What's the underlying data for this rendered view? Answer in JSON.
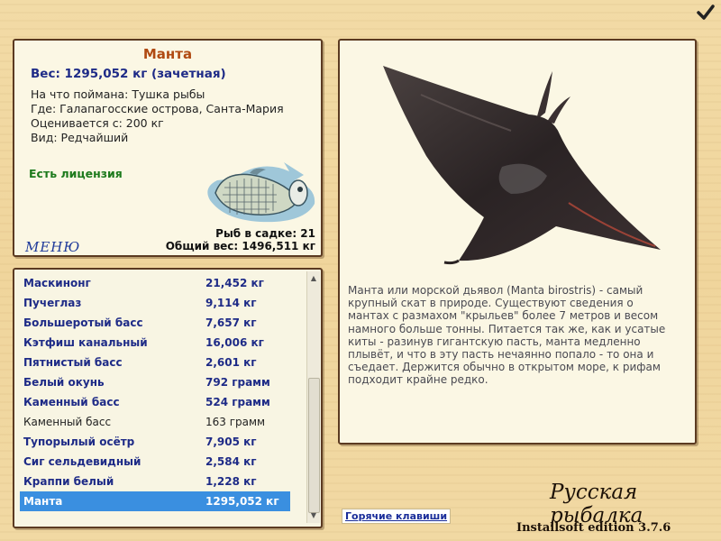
{
  "fish": {
    "name": "Манта",
    "weight": "Вес: 1295,052 кг (зачетная)",
    "caught_on": "На что поймана: Тушка рыбы",
    "location": "Где: Галапагосские острова, Санта-Мария",
    "valued_from": "Оценивается с: 200 кг",
    "species_type": "Вид: Редчайший",
    "license": "Есть лицензия",
    "description": "Манта или морской дьявол (Manta birostris) - самый крупный скат в природе. Существуют сведения о мантах с размахом \"крыльев\" более 7 метров и весом намного больше тонны. Питается так же, как и усатые киты - разинув гигантскую пасть, манта медленно плывёт, и что в эту пасть нечаянно попало - то она и съедает. Держится обычно в открытом море, к рифам подходит крайне редко."
  },
  "menu_label": "МЕНЮ",
  "stats": {
    "fish_in_keepnet": "Рыб в садке: 21",
    "total_weight": "Общий вес: 1496,511 кг"
  },
  "catch_list": [
    {
      "name": "Маскинонг",
      "weight": "21,452 кг",
      "bold": true
    },
    {
      "name": "Пучеглаз",
      "weight": "9,114 кг",
      "bold": true
    },
    {
      "name": "Большеротый басс",
      "weight": "7,657 кг",
      "bold": true
    },
    {
      "name": "Кэтфиш канальный",
      "weight": "16,006 кг",
      "bold": true
    },
    {
      "name": "Пятнистый басс",
      "weight": "2,601 кг",
      "bold": true
    },
    {
      "name": "Белый окунь",
      "weight": "792 грамм",
      "bold": true
    },
    {
      "name": "Каменный басс",
      "weight": "524 грамм",
      "bold": true
    },
    {
      "name": "Каменный басс",
      "weight": "163 грамм",
      "bold": false
    },
    {
      "name": "Тупорылый осётр",
      "weight": "7,905 кг",
      "bold": true
    },
    {
      "name": "Сиг сельдевидный",
      "weight": "2,584 кг",
      "bold": true
    },
    {
      "name": "Краппи белый",
      "weight": "1,228 кг",
      "bold": true
    },
    {
      "name": "Манта",
      "weight": "1295,052 кг",
      "bold": true,
      "selected": true
    }
  ],
  "hotkeys_label": "Горячие клавиши",
  "brand": "Русская рыбалка",
  "edition": "Installsoft edition 3.7.6",
  "icons": {
    "confirm": "checkmark-icon",
    "scroll_up": "arrow-up-icon",
    "scroll_down": "arrow-down-icon"
  },
  "colors": {
    "title": "#b04a12",
    "weight": "#1e2b87",
    "license": "#1c7a1c",
    "selection": "#3a8fe0"
  }
}
